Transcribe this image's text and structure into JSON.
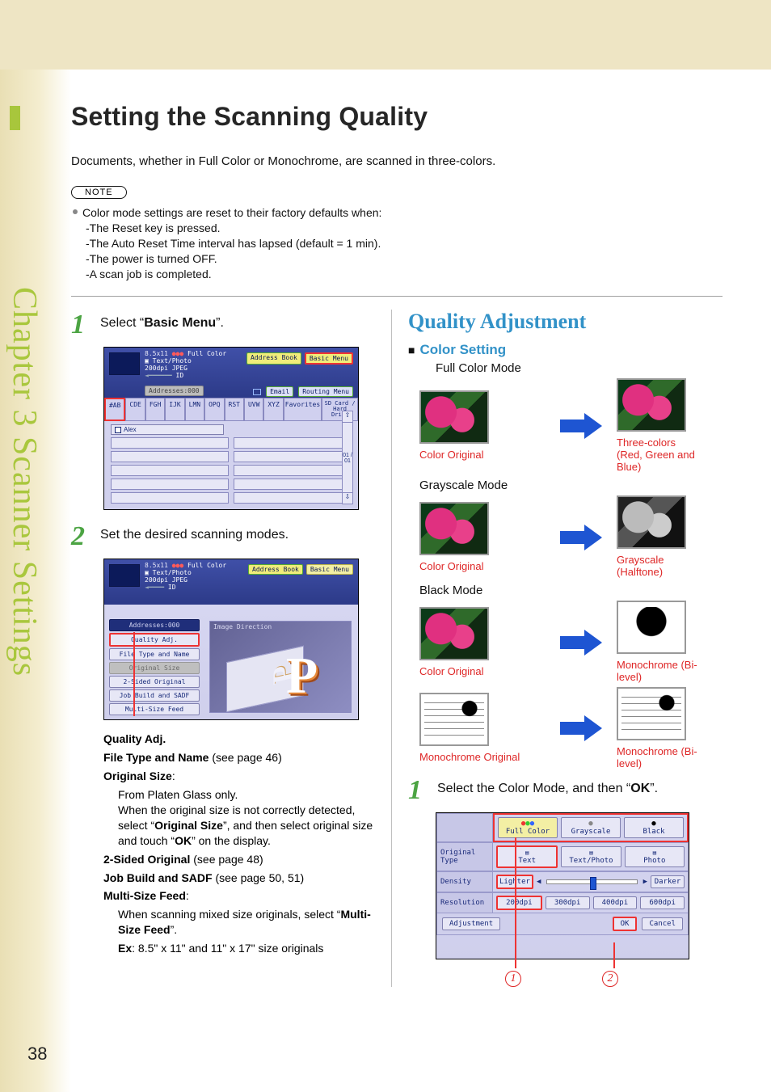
{
  "domain": "Document",
  "page_number": "38",
  "side_chapter_label": "Chapter 3  Scanner Settings",
  "title": "Setting the Scanning Quality",
  "intro": "Documents, whether in Full Color or Monochrome, are scanned in three-colors.",
  "note_badge": "NOTE",
  "note_lines": {
    "bullet": "Color mode settings are reset to their factory defaults when:",
    "items": [
      "-The Reset key is pressed.",
      "-The Auto Reset Time interval has lapsed (default = 1 min).",
      "-The power is turned OFF.",
      "-A scan job is completed."
    ]
  },
  "step1": {
    "num": "1",
    "pre": "Select “",
    "bold": "Basic Menu",
    "post": "”."
  },
  "step2": {
    "num": "2",
    "text": "Set the desired scanning modes."
  },
  "screenshot1": {
    "size_label": "8.5x11",
    "color_label": "Full Color",
    "type_label": "Text/Photo",
    "dpi_label": "200dpi JPEG",
    "id_label": "ID",
    "addresses_label": "Addresses:000",
    "top_buttons": [
      "Address Book",
      "Basic Menu"
    ],
    "mid_buttons": [
      "Email",
      "Routing Menu"
    ],
    "tabs": [
      "#AB",
      "CDE",
      "FGH",
      "IJK",
      "LMN",
      "OPQ",
      "RST",
      "UVW",
      "XYZ",
      "Favorites",
      "SD Card / Hard Drive"
    ],
    "entry": "Alex",
    "scroll_label": "01 / 01"
  },
  "screenshot2": {
    "left_menu": [
      "Addresses:000",
      "Quality Adj.",
      "File Type and Name",
      "Original Size",
      "2-Sided Original",
      "Job Build and SADF",
      "Multi-Size Feed"
    ],
    "preview_label": "Image Direction",
    "top_buttons": [
      "Address Book",
      "Basic Menu"
    ],
    "size_label": "8.5x11",
    "color_label": "Full Color",
    "type_label": "Text/Photo",
    "dpi_label": "200dpi JPEG",
    "id_label": "ID"
  },
  "definitions": {
    "quality": "Quality Adj.",
    "filetype_pre": "File Type and Name",
    "filetype_post": " (see page 46)",
    "origsize_label": "Original Size",
    "origsize_colon": ":",
    "origsize_line1": "From Platen Glass only.",
    "origsize_line2a": "When the original size is not correctly detected, select “",
    "origsize_line2bold1": "Original Size",
    "origsize_line2b": "”, and then select original size and touch “",
    "origsize_line2bold2": "OK",
    "origsize_line2c": "” on the display.",
    "twosided_pre": "2-Sided Original",
    "twosided_post": " (see page 48)",
    "jobbuild_pre": "Job Build and SADF",
    "jobbuild_post": " (see page 50, 51)",
    "multisize_label": "Multi-Size Feed",
    "multisize_colon": ":",
    "multisize_desc_a": "When scanning mixed size originals, select “",
    "multisize_desc_bold": "Multi-Size Feed",
    "multisize_desc_b": "”.",
    "multisize_ex_pre": "Ex",
    "multisize_ex_post": ": 8.5\" x 11\" and 11\" x 17\" size originals"
  },
  "right": {
    "heading": "Quality Adjustment",
    "subheading": "Color Setting",
    "subsquare": "■",
    "full_color_label": "Full Color Mode",
    "grayscale_label": "Grayscale Mode",
    "black_label": "Black Mode",
    "captions": {
      "color_original": "Color Original",
      "three_colors": "Three-colors (Red, Green and Blue)",
      "grayscale_halftone": "Grayscale (Halftone)",
      "monochrome_bilevel": "Monochrome (Bi-level)",
      "monochrome_original": "Monochrome Original"
    },
    "step1": {
      "num": "1",
      "pre": "Select the Color Mode, and then “",
      "bold": "OK",
      "post": "”."
    },
    "circles": [
      "1",
      "2"
    ]
  },
  "screenshot3": {
    "header_row": [
      "Full Color",
      "Grayscale",
      "Black"
    ],
    "rows": [
      {
        "label": "Original Type",
        "cells": [
          "Text",
          "Text/Photo",
          "Photo"
        ]
      },
      {
        "label": "Density",
        "cells_special": {
          "left": "Lighter",
          "right": "Darker"
        }
      },
      {
        "label": "Resolution",
        "cells": [
          "200dpi",
          "300dpi",
          "400dpi",
          "600dpi"
        ]
      }
    ],
    "footer": {
      "left": "Adjustment",
      "ok": "OK",
      "cancel": "Cancel"
    }
  }
}
